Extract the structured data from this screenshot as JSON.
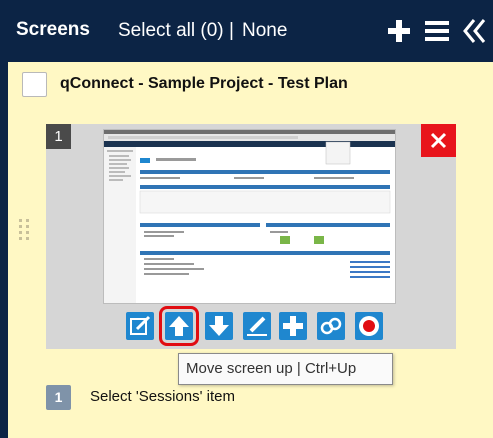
{
  "header": {
    "title": "Screens",
    "select_all": "Select all (0)",
    "separator": "|",
    "none": "None",
    "icons": [
      "plus-icon",
      "menu-icon",
      "collapse-icon"
    ]
  },
  "project": {
    "title": "qConnect - Sample Project - Test Plan",
    "checked": false
  },
  "screen_card": {
    "number": "1",
    "close_icon": "close-icon",
    "toolbar": [
      {
        "name": "edit-screen-button",
        "icon": "edit-icon"
      },
      {
        "name": "move-up-button",
        "icon": "arrow-up-icon",
        "highlighted": true
      },
      {
        "name": "move-down-button",
        "icon": "arrow-down-icon"
      },
      {
        "name": "annotate-button",
        "icon": "pen-icon"
      },
      {
        "name": "add-screen-button",
        "icon": "plus-icon"
      },
      {
        "name": "link-button",
        "icon": "link-icon"
      },
      {
        "name": "record-button",
        "icon": "record-icon"
      }
    ]
  },
  "tooltip": "Move screen up | Ctrl+Up",
  "step": {
    "number": "1",
    "text": "Select 'Sessions' item"
  },
  "colors": {
    "header_bg": "#0c2445",
    "panel_bg": "#fff8c4",
    "accent_blue": "#1f87cf",
    "close_red": "#e8141b",
    "highlight_red": "#e10d12",
    "badge_gray": "#7f93a9"
  }
}
